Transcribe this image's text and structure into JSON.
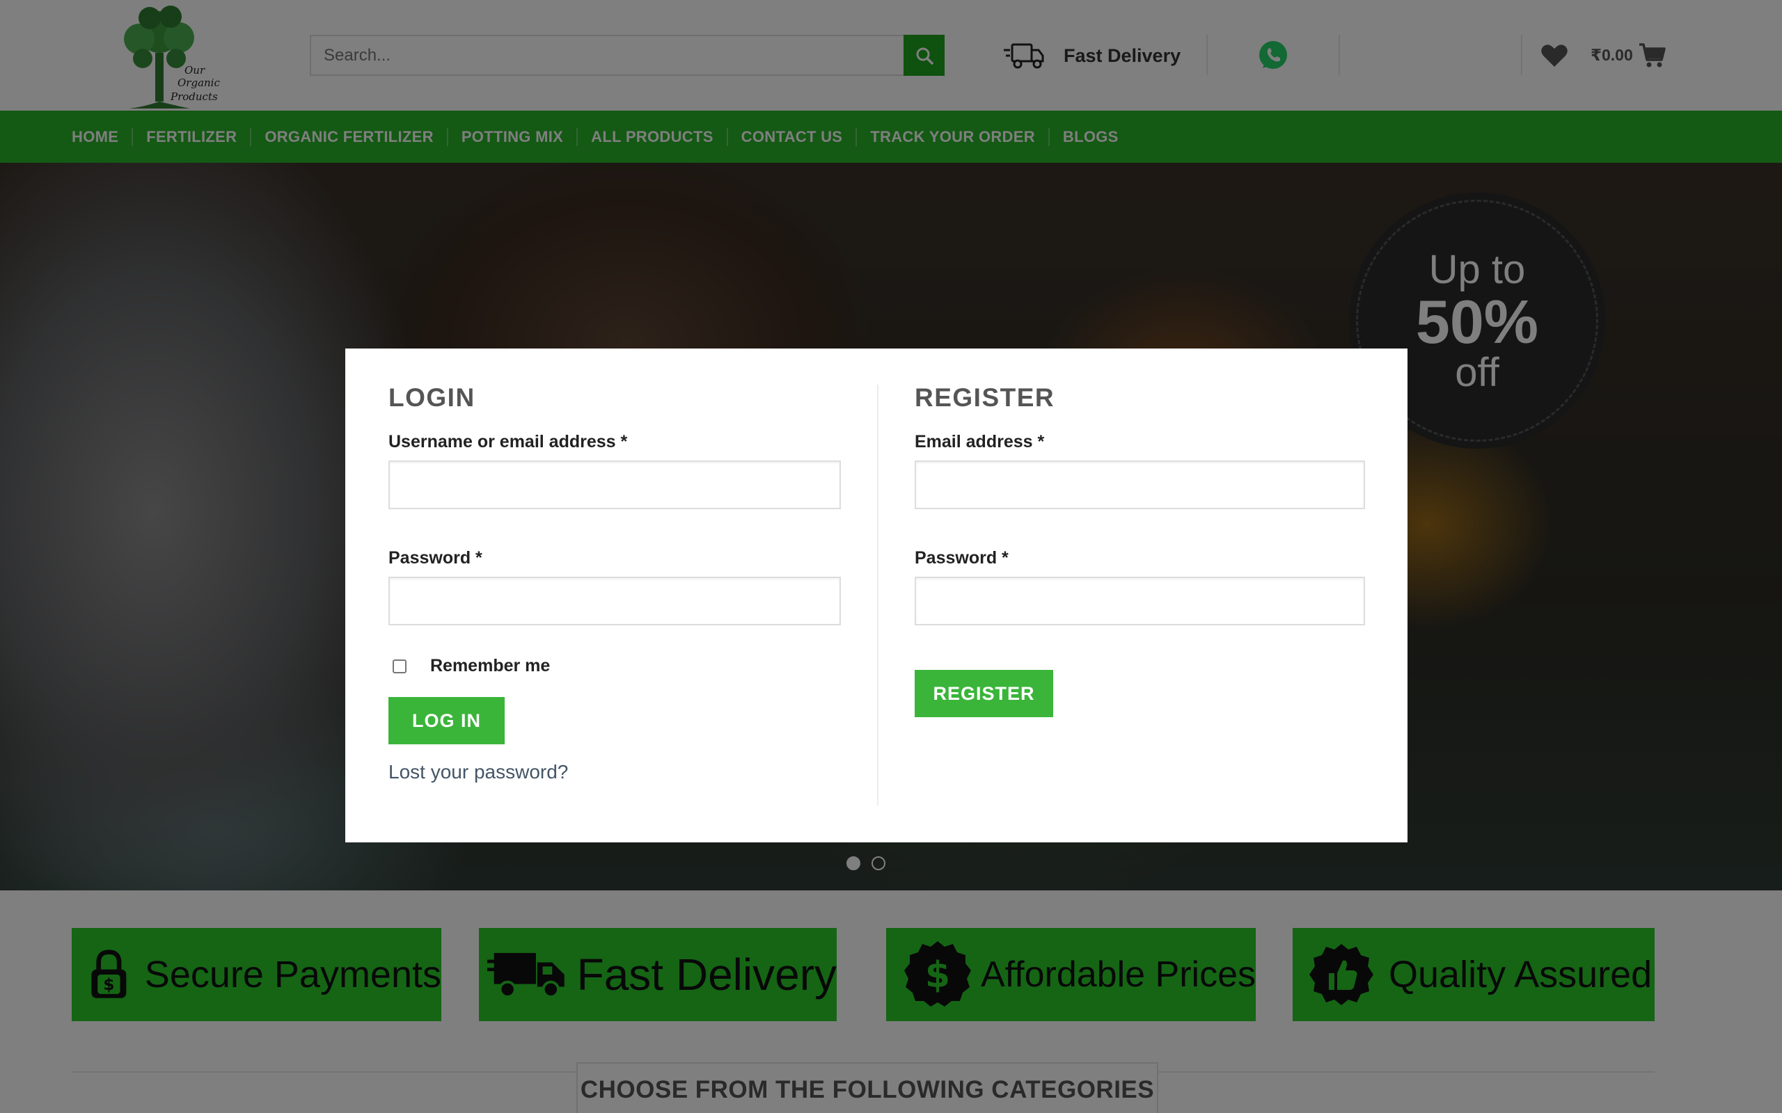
{
  "header": {
    "logo_text": "Our Organic Products",
    "search_placeholder": "Search...",
    "fast_delivery_label": "Fast Delivery",
    "cart_amount": "₹0.00"
  },
  "nav": {
    "items": [
      "HOME",
      "FERTILIZER",
      "ORGANIC FERTILIZER",
      "POTTING MIX",
      "ALL PRODUCTS",
      "CONTACT US",
      "TRACK YOUR ORDER",
      "BLOGS"
    ]
  },
  "hero": {
    "badge_line1": "Up to",
    "badge_line2": "50%",
    "badge_line3": "off",
    "slide_count": 2,
    "active_slide": 1
  },
  "features": [
    {
      "label": "Secure Payments",
      "icon": "lock-dollar-icon"
    },
    {
      "label": "Fast Delivery",
      "icon": "truck-icon"
    },
    {
      "label": "Affordable Prices",
      "icon": "dollar-badge-icon"
    },
    {
      "label": "Quality Assured",
      "icon": "thumbs-up-badge-icon"
    }
  ],
  "categories_title": "CHOOSE FROM THE FOLLOWING CATEGORIES",
  "modal": {
    "login": {
      "title": "LOGIN",
      "username_label": "Username or email address *",
      "username_value": "",
      "password_label": "Password *",
      "password_value": "",
      "remember_label": "Remember me",
      "remember_checked": false,
      "submit_label": "LOG IN",
      "lost_password_link": "Lost your password?"
    },
    "register": {
      "title": "REGISTER",
      "email_label": "Email address *",
      "email_value": "",
      "password_label": "Password *",
      "password_value": "",
      "submit_label": "REGISTER"
    }
  },
  "colors": {
    "nav_green": "#29b229",
    "button_green": "#3ab53a",
    "feature_green": "#2bcb2b",
    "search_btn_green": "#1fa31f",
    "whatsapp_green": "#25d366"
  }
}
